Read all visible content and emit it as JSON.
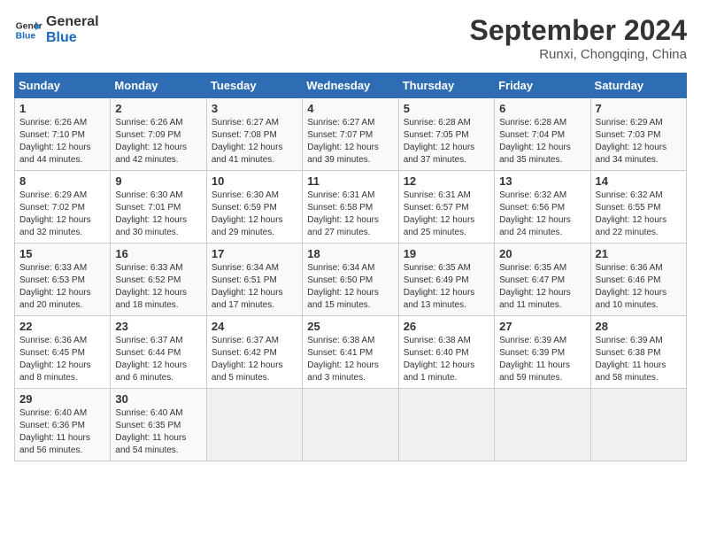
{
  "header": {
    "logo_line1": "General",
    "logo_line2": "Blue",
    "month_title": "September 2024",
    "location": "Runxi, Chongqing, China"
  },
  "days_of_week": [
    "Sunday",
    "Monday",
    "Tuesday",
    "Wednesday",
    "Thursday",
    "Friday",
    "Saturday"
  ],
  "weeks": [
    [
      {
        "day": "1",
        "sunrise": "6:26 AM",
        "sunset": "7:10 PM",
        "daylight": "12 hours and 44 minutes."
      },
      {
        "day": "2",
        "sunrise": "6:26 AM",
        "sunset": "7:09 PM",
        "daylight": "12 hours and 42 minutes."
      },
      {
        "day": "3",
        "sunrise": "6:27 AM",
        "sunset": "7:08 PM",
        "daylight": "12 hours and 41 minutes."
      },
      {
        "day": "4",
        "sunrise": "6:27 AM",
        "sunset": "7:07 PM",
        "daylight": "12 hours and 39 minutes."
      },
      {
        "day": "5",
        "sunrise": "6:28 AM",
        "sunset": "7:05 PM",
        "daylight": "12 hours and 37 minutes."
      },
      {
        "day": "6",
        "sunrise": "6:28 AM",
        "sunset": "7:04 PM",
        "daylight": "12 hours and 35 minutes."
      },
      {
        "day": "7",
        "sunrise": "6:29 AM",
        "sunset": "7:03 PM",
        "daylight": "12 hours and 34 minutes."
      }
    ],
    [
      {
        "day": "8",
        "sunrise": "6:29 AM",
        "sunset": "7:02 PM",
        "daylight": "12 hours and 32 minutes."
      },
      {
        "day": "9",
        "sunrise": "6:30 AM",
        "sunset": "7:01 PM",
        "daylight": "12 hours and 30 minutes."
      },
      {
        "day": "10",
        "sunrise": "6:30 AM",
        "sunset": "6:59 PM",
        "daylight": "12 hours and 29 minutes."
      },
      {
        "day": "11",
        "sunrise": "6:31 AM",
        "sunset": "6:58 PM",
        "daylight": "12 hours and 27 minutes."
      },
      {
        "day": "12",
        "sunrise": "6:31 AM",
        "sunset": "6:57 PM",
        "daylight": "12 hours and 25 minutes."
      },
      {
        "day": "13",
        "sunrise": "6:32 AM",
        "sunset": "6:56 PM",
        "daylight": "12 hours and 24 minutes."
      },
      {
        "day": "14",
        "sunrise": "6:32 AM",
        "sunset": "6:55 PM",
        "daylight": "12 hours and 22 minutes."
      }
    ],
    [
      {
        "day": "15",
        "sunrise": "6:33 AM",
        "sunset": "6:53 PM",
        "daylight": "12 hours and 20 minutes."
      },
      {
        "day": "16",
        "sunrise": "6:33 AM",
        "sunset": "6:52 PM",
        "daylight": "12 hours and 18 minutes."
      },
      {
        "day": "17",
        "sunrise": "6:34 AM",
        "sunset": "6:51 PM",
        "daylight": "12 hours and 17 minutes."
      },
      {
        "day": "18",
        "sunrise": "6:34 AM",
        "sunset": "6:50 PM",
        "daylight": "12 hours and 15 minutes."
      },
      {
        "day": "19",
        "sunrise": "6:35 AM",
        "sunset": "6:49 PM",
        "daylight": "12 hours and 13 minutes."
      },
      {
        "day": "20",
        "sunrise": "6:35 AM",
        "sunset": "6:47 PM",
        "daylight": "12 hours and 11 minutes."
      },
      {
        "day": "21",
        "sunrise": "6:36 AM",
        "sunset": "6:46 PM",
        "daylight": "12 hours and 10 minutes."
      }
    ],
    [
      {
        "day": "22",
        "sunrise": "6:36 AM",
        "sunset": "6:45 PM",
        "daylight": "12 hours and 8 minutes."
      },
      {
        "day": "23",
        "sunrise": "6:37 AM",
        "sunset": "6:44 PM",
        "daylight": "12 hours and 6 minutes."
      },
      {
        "day": "24",
        "sunrise": "6:37 AM",
        "sunset": "6:42 PM",
        "daylight": "12 hours and 5 minutes."
      },
      {
        "day": "25",
        "sunrise": "6:38 AM",
        "sunset": "6:41 PM",
        "daylight": "12 hours and 3 minutes."
      },
      {
        "day": "26",
        "sunrise": "6:38 AM",
        "sunset": "6:40 PM",
        "daylight": "12 hours and 1 minute."
      },
      {
        "day": "27",
        "sunrise": "6:39 AM",
        "sunset": "6:39 PM",
        "daylight": "11 hours and 59 minutes."
      },
      {
        "day": "28",
        "sunrise": "6:39 AM",
        "sunset": "6:38 PM",
        "daylight": "11 hours and 58 minutes."
      }
    ],
    [
      {
        "day": "29",
        "sunrise": "6:40 AM",
        "sunset": "6:36 PM",
        "daylight": "11 hours and 56 minutes."
      },
      {
        "day": "30",
        "sunrise": "6:40 AM",
        "sunset": "6:35 PM",
        "daylight": "11 hours and 54 minutes."
      },
      null,
      null,
      null,
      null,
      null
    ]
  ]
}
